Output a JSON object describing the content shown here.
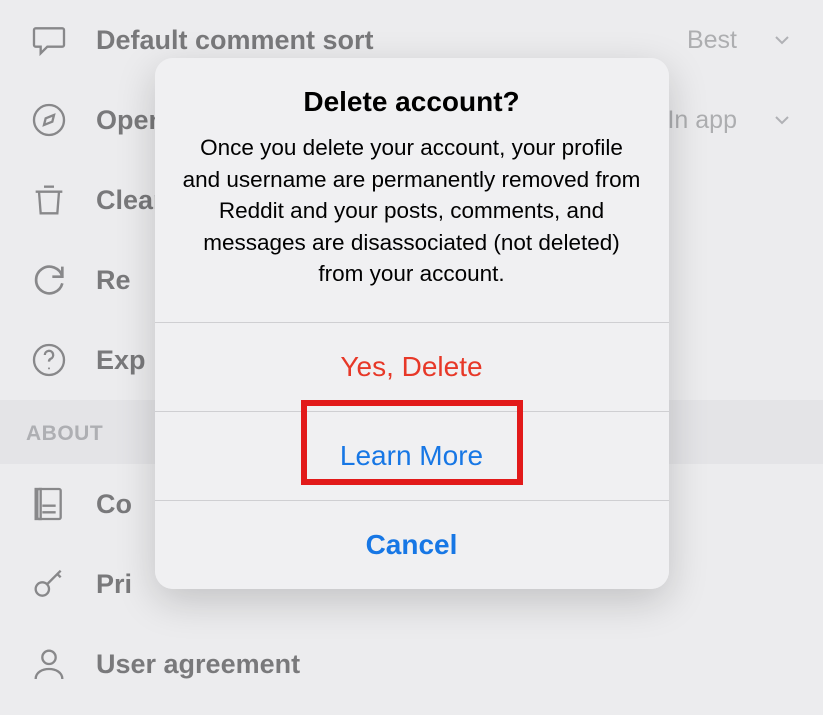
{
  "settings": {
    "rows": {
      "comment_sort": {
        "label": "Default comment sort",
        "value": "Best"
      },
      "open_links": {
        "label": "Open links",
        "value": "In app"
      },
      "clear": {
        "label": "Clear"
      },
      "re": {
        "label": "Re"
      },
      "exp": {
        "label": "Exp"
      },
      "content": {
        "label": "Co"
      },
      "privacy": {
        "label": "Pri"
      },
      "user_agree": {
        "label": "User agreement"
      }
    },
    "section_about": "ABOUT"
  },
  "dialog": {
    "title": "Delete account?",
    "message": "Once you delete your account, your profile and username are permanently removed from Reddit and your posts, comments, and messages are disassociated (not deleted) from your account.",
    "actions": {
      "delete": "Yes, Delete",
      "learn_more": "Learn More",
      "cancel": "Cancel"
    }
  }
}
